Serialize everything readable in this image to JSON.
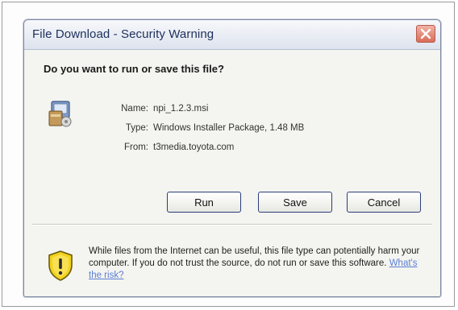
{
  "window": {
    "title": "File Download - Security Warning"
  },
  "dialog": {
    "question": "Do you want to run or save this file?",
    "file": {
      "name_label": "Name:",
      "name_value": "npi_1.2.3.msi",
      "type_label": "Type:",
      "type_value": "Windows Installer Package, 1.48 MB",
      "from_label": "From:",
      "from_value": "t3media.toyota.com"
    },
    "buttons": {
      "run": "Run",
      "save": "Save",
      "cancel": "Cancel"
    },
    "warning": {
      "text": "While files from the Internet can be useful, this file type can potentially harm your computer. If you do not trust the source, do not run or save this software.",
      "link": "What's the risk?"
    }
  },
  "icons": {
    "close": "close-icon",
    "installer": "installer-package-icon",
    "shield": "security-shield-icon"
  },
  "colors": {
    "title_text": "#1d2f5c",
    "close_button": "#d96c58",
    "link": "#5b7fd6",
    "shield_yellow": "#f2d21b"
  }
}
